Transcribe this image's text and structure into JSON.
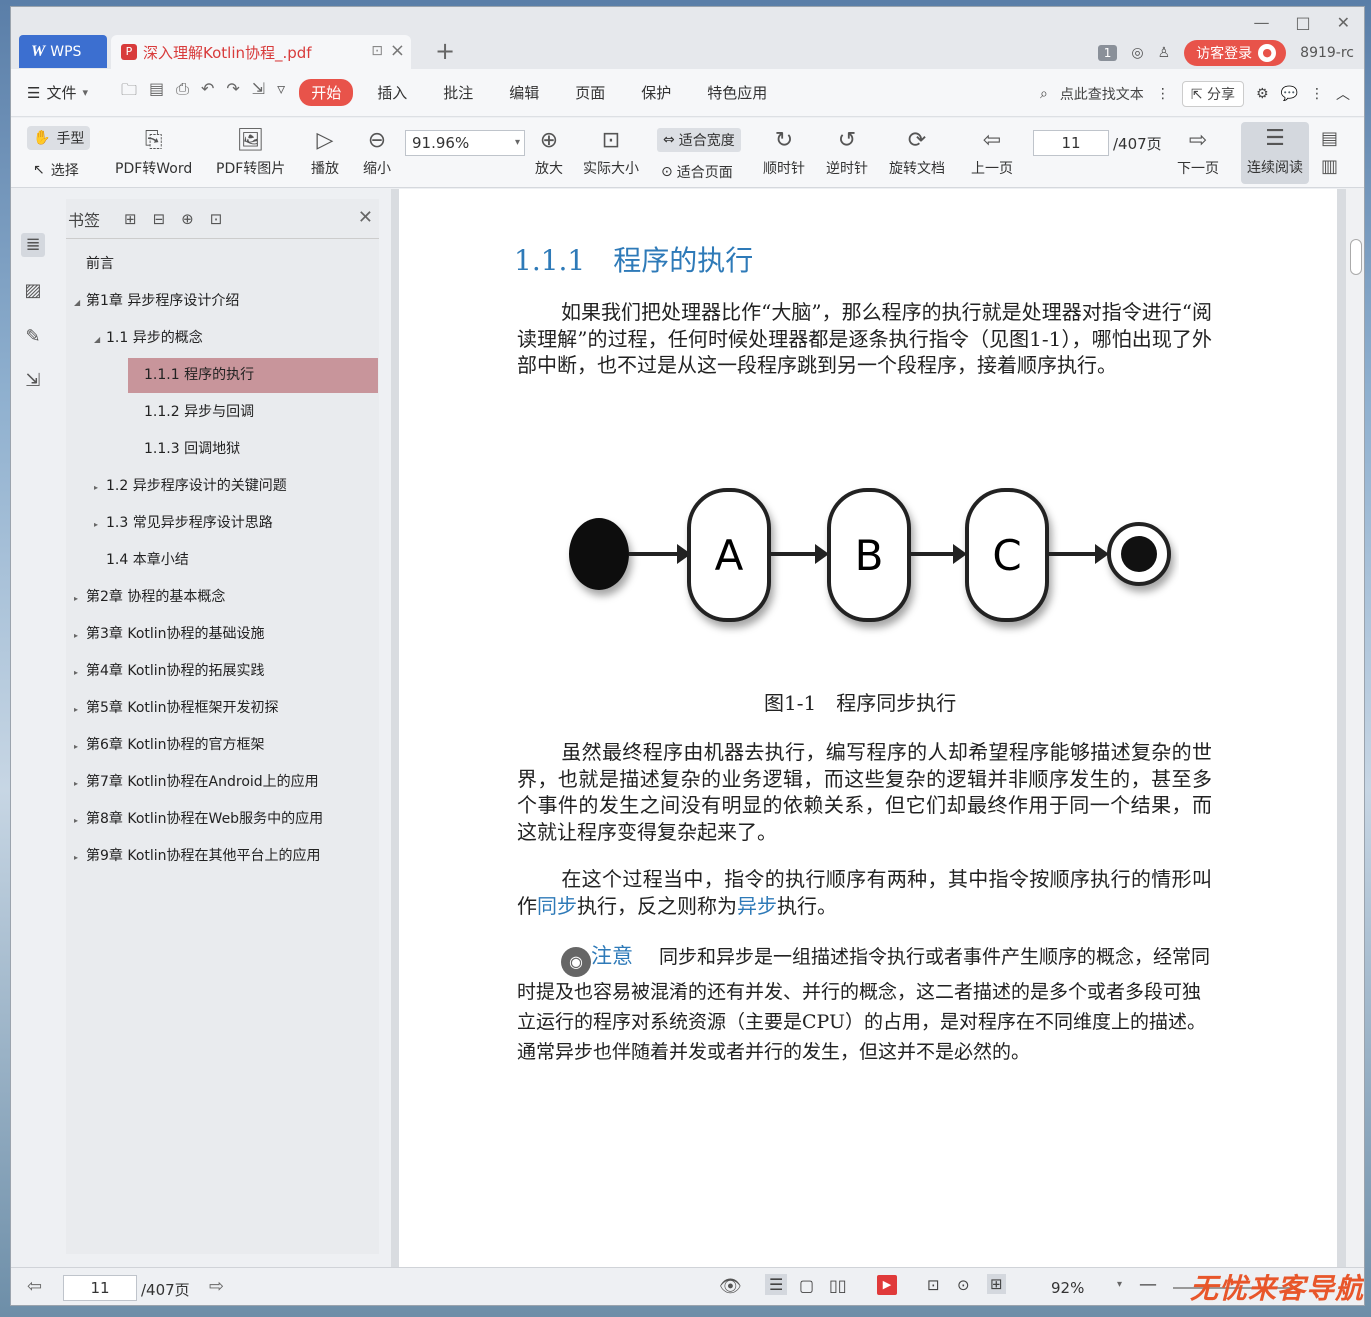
{
  "window": {
    "app_tab": "WPS",
    "doc_tab": "深入理解Kotlin协程_.pdf",
    "badge": "1",
    "login": "访客登录",
    "user_id": "8919-rc"
  },
  "menu": {
    "file": "文件",
    "tabs": [
      "开始",
      "插入",
      "批注",
      "编辑",
      "页面",
      "保护",
      "特色应用"
    ],
    "search": "点此查找文本",
    "share": "分享"
  },
  "toolbar": {
    "hand": "手型",
    "select": "选择",
    "pdf2word": "PDF转Word",
    "pdf2img": "PDF转图片",
    "play": "播放",
    "zoom_out": "缩小",
    "zoom_value": "91.96%",
    "zoom_in": "放大",
    "actual_size": "实际大小",
    "fit_width": "适合宽度",
    "fit_page": "适合页面",
    "clockwise": "顺时针",
    "counterclockwise": "逆时针",
    "rotate_doc": "旋转文档",
    "prev_page": "上一页",
    "page_value": "11",
    "page_total": "/407页",
    "next_page": "下一页",
    "continuous": "连续阅读"
  },
  "bookmarks": {
    "title": "书签",
    "items": [
      {
        "label": "前言",
        "level": 0,
        "tri": ""
      },
      {
        "label": "第1章 异步程序设计介绍",
        "level": 0,
        "tri": "◢"
      },
      {
        "label": "1.1 异步的概念",
        "level": 1,
        "tri": "◢"
      },
      {
        "label": "1.1.1 程序的执行",
        "level": 2,
        "tri": "",
        "selected": true
      },
      {
        "label": "1.1.2 异步与回调",
        "level": 2,
        "tri": ""
      },
      {
        "label": "1.1.3 回调地狱",
        "level": 2,
        "tri": ""
      },
      {
        "label": "1.2 异步程序设计的关键问题",
        "level": 1,
        "tri": "▸"
      },
      {
        "label": "1.3 常见异步程序设计思路",
        "level": 1,
        "tri": "▸"
      },
      {
        "label": "1.4 本章小结",
        "level": 1,
        "tri": ""
      },
      {
        "label": "第2章 协程的基本概念",
        "level": 0,
        "tri": "▸"
      },
      {
        "label": "第3章 Kotlin协程的基础设施",
        "level": 0,
        "tri": "▸"
      },
      {
        "label": "第4章 Kotlin协程的拓展实践",
        "level": 0,
        "tri": "▸"
      },
      {
        "label": "第5章 Kotlin协程框架开发初探",
        "level": 0,
        "tri": "▸"
      },
      {
        "label": "第6章 Kotlin协程的官方框架",
        "level": 0,
        "tri": "▸"
      },
      {
        "label": "第7章 Kotlin协程在Android上的应用",
        "level": 0,
        "tri": "▸"
      },
      {
        "label": "第8章 Kotlin协程在Web服务中的应用",
        "level": 0,
        "tri": "▸"
      },
      {
        "label": "第9章 Kotlin协程在其他平台上的应用",
        "level": 0,
        "tri": "▸"
      }
    ]
  },
  "doc": {
    "heading": "1.1.1　程序的执行",
    "para1": "如果我们把处理器比作“大脑”，那么程序的执行就是处理器对指令进行“阅读理解”的过程，任何时候处理器都是逐条执行指令（见图1-1），哪怕出现了外部中断，也不过是从这一段程序跳到另一个段程序，接着顺序执行。",
    "diagram_nodes": [
      "A",
      "B",
      "C"
    ],
    "caption": "图1-1　程序同步执行",
    "para2": "虽然最终程序由机器去执行，编写程序的人却希望程序能够描述复杂的世界，也就是描述复杂的业务逻辑，而这些复杂的逻辑并非顺序发生的，甚至多个事件的发生之间没有明显的依赖关系，但它们却最终作用于同一个结果，而这就让程序变得复杂起来了。",
    "para3_a": "在这个过程当中，指令的执行顺序有两种，其中指令按顺序执行的情形叫作",
    "para3_sync": "同步",
    "para3_b": "执行，反之则称为",
    "para3_async": "异步",
    "para3_c": "执行。",
    "note_label": "注意",
    "note_text": "同步和异步是一组描述指令执行或者事件产生顺序的概念，经常同时提及也容易被混淆的还有并发、并行的概念，这二者描述的是多个或者多段可独立运行的程序对系统资源（主要是CPU）的占用，是对程序在不同维度上的描述。通常异步也伴随着并发或者并行的发生，但这并不是必然的。"
  },
  "status": {
    "page": "11",
    "total": "/407页",
    "zoom": "92%",
    "watermark": "无忧来客导航"
  }
}
